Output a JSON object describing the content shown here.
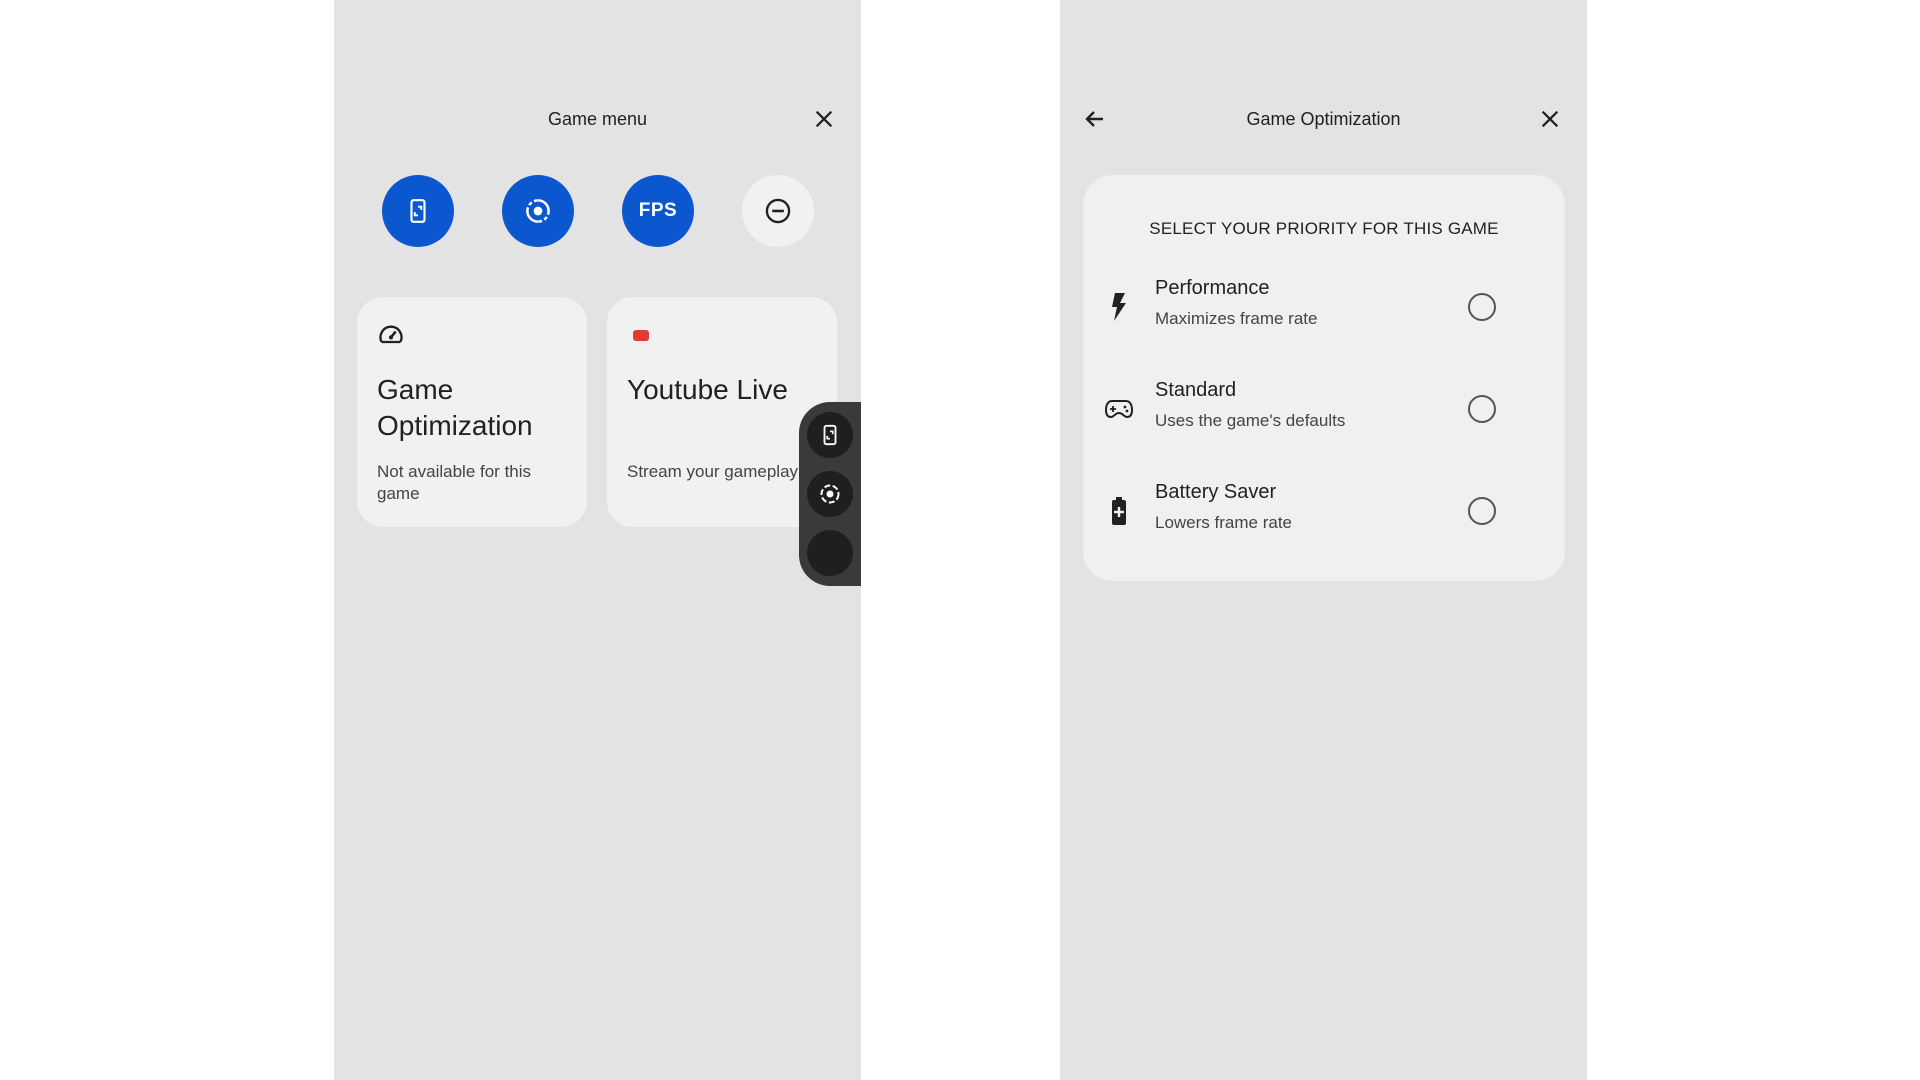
{
  "left_panel": {
    "title": "Game menu",
    "quick_buttons": [
      {
        "icon": "phone-screenshot-icon",
        "state": "on"
      },
      {
        "icon": "record-icon",
        "state": "on"
      },
      {
        "label": "FPS",
        "state": "on"
      },
      {
        "icon": "do-not-disturb-icon",
        "state": "off"
      }
    ],
    "tiles": [
      {
        "icon": "speedometer-icon",
        "title": "Game Optimization",
        "subtitle": "Not available for this game"
      },
      {
        "icon": "youtube-icon",
        "title": "Youtube Live",
        "subtitle": "Stream your gameplay"
      }
    ],
    "floating_controls": [
      "phone-screenshot-icon",
      "record-icon",
      "blank-button"
    ]
  },
  "right_panel": {
    "title": "Game Optimization",
    "heading": "SELECT YOUR PRIORITY FOR THIS GAME",
    "options": [
      {
        "icon": "lightning-bolt-icon",
        "label": "Performance",
        "description": "Maximizes frame rate",
        "selected": false
      },
      {
        "icon": "gamepad-icon",
        "label": "Standard",
        "description": "Uses the game's defaults",
        "selected": false
      },
      {
        "icon": "battery-plus-icon",
        "label": "Battery Saver",
        "description": "Lowers frame rate",
        "selected": false
      }
    ]
  },
  "colors": {
    "panel_bg": "#e3e3e3",
    "card_bg": "#f1f1f1",
    "accent_blue": "#0b57d0",
    "youtube_red": "#e53935",
    "pill_bg": "#3a3a3a"
  }
}
